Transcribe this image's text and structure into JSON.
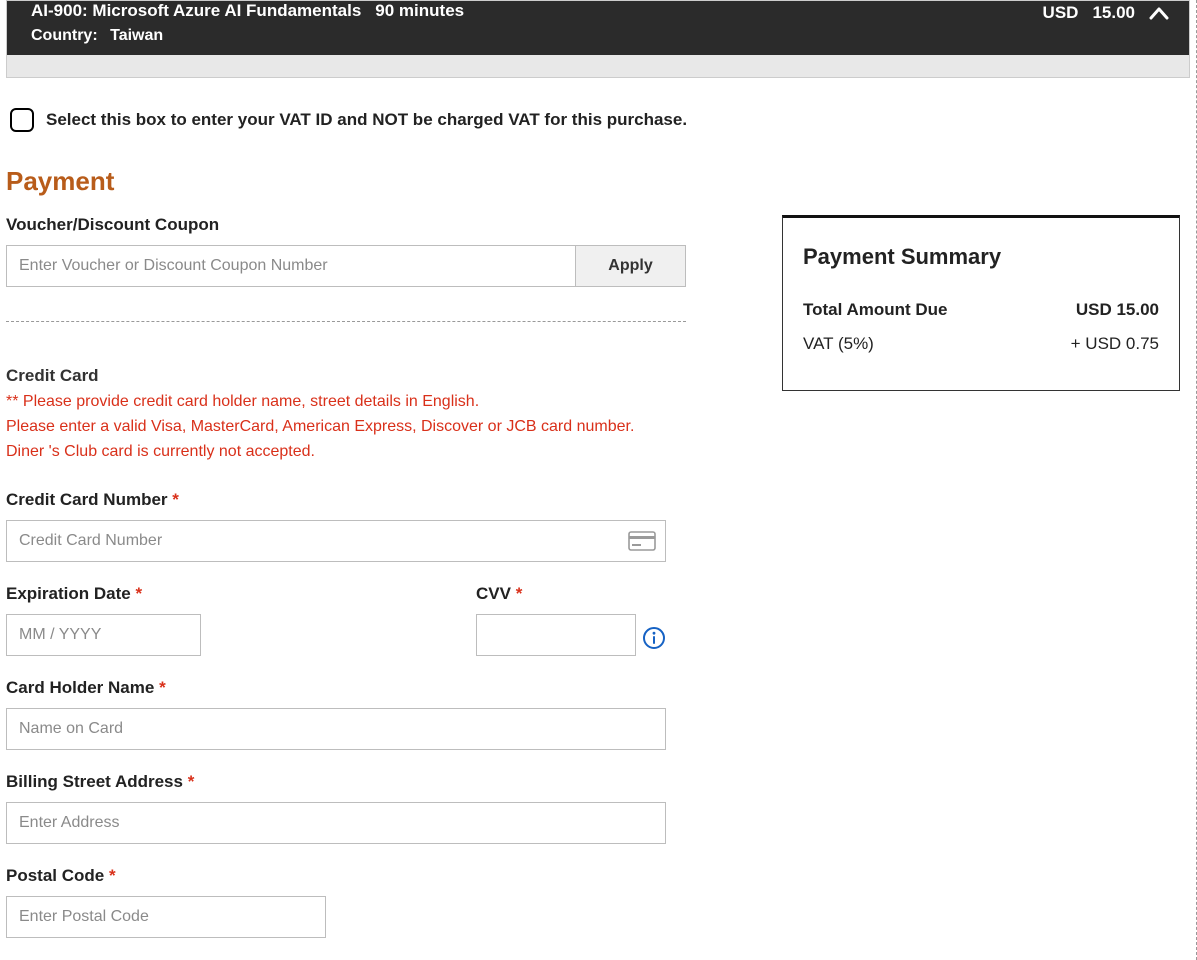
{
  "order": {
    "exam_title": "AI-900: Microsoft Azure AI Fundamentals",
    "duration": "90 minutes",
    "country_label": "Country:",
    "country_value": "Taiwan",
    "currency": "USD",
    "price": "15.00"
  },
  "vat_checkbox": {
    "label": "Select this box to enter your VAT ID and NOT be charged VAT for this purchase.",
    "checked": false
  },
  "headings": {
    "payment": "Payment"
  },
  "voucher": {
    "label": "Voucher/Discount Coupon",
    "placeholder": "Enter Voucher or Discount Coupon Number",
    "apply_label": "Apply"
  },
  "credit_card": {
    "section_title": "Credit Card",
    "warning_line1": "** Please provide credit card holder name, street details in English.",
    "warning_line2": "Please enter a valid Visa, MasterCard, American Express, Discover or JCB card number.",
    "warning_line3": "Diner 's Club card is currently not accepted.",
    "number_label": "Credit Card Number",
    "number_placeholder": "Credit Card Number",
    "expiration_label": "Expiration Date",
    "expiration_placeholder": "MM / YYYY",
    "cvv_label": "CVV",
    "holder_label": "Card Holder Name",
    "holder_placeholder": "Name on Card",
    "billing_label": "Billing Street Address",
    "billing_placeholder": "Enter Address",
    "postal_label": "Postal Code",
    "postal_placeholder": "Enter Postal Code",
    "required_mark": "*"
  },
  "summary": {
    "title": "Payment Summary",
    "total_label": "Total Amount Due",
    "total_value": "USD 15.00",
    "vat_label": "VAT (5%)",
    "vat_value": "+ USD 0.75"
  }
}
